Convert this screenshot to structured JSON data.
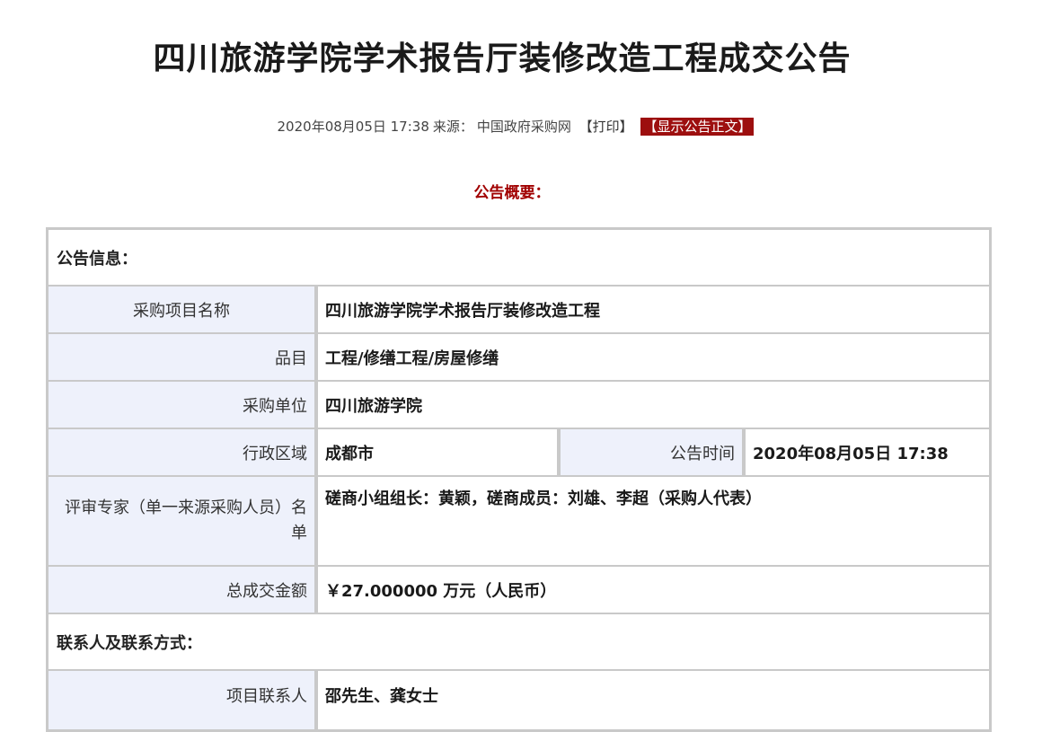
{
  "title": "四川旅游学院学术报告厅装修改造工程成交公告",
  "meta": {
    "datetime": "2020年08月05日 17:38",
    "source_label": "来源：",
    "source": "中国政府采购网",
    "print": "【打印】",
    "show_notice": "【显示公告正文】"
  },
  "summary_heading": "公告概要：",
  "sections": {
    "notice_info": "公告信息：",
    "contact": "联系人及联系方式："
  },
  "rows": {
    "project_name": {
      "label": "采购项目名称",
      "value": "四川旅游学院学术报告厅装修改造工程"
    },
    "category": {
      "label": "品目",
      "value": "工程/修缮工程/房屋修缮"
    },
    "purchaser": {
      "label": "采购单位",
      "value": "四川旅游学院"
    },
    "region": {
      "label": "行政区域",
      "value": "成都市"
    },
    "notice_time": {
      "label": "公告时间",
      "value": "2020年08月05日 17:38"
    },
    "experts": {
      "label": "评审专家（单一来源采购人员）名单",
      "value": "磋商小组组长：黄颖，磋商成员：刘雄、李超（采购人代表）"
    },
    "total_amount": {
      "label": "总成交金额",
      "value": "￥27.000000 万元（人民币）"
    },
    "project_contact": {
      "label": "项目联系人",
      "value": "邵先生、龚女士"
    }
  },
  "colors": {
    "accent_red": "#a10000",
    "button_red": "#9d0f0f",
    "label_bg": "#eef1fb",
    "border": "#c9c9c9"
  }
}
